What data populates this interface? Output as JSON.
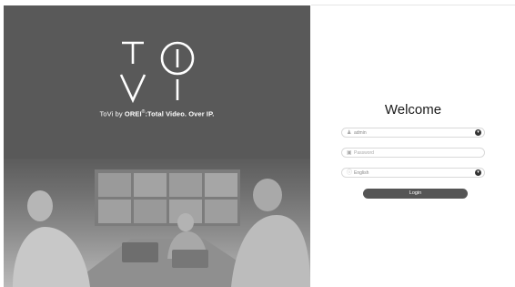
{
  "brand": {
    "logo_text": "ToVi",
    "tagline_prefix": "ToVi",
    "tagline_by": "by",
    "tagline_company": "OREI",
    "tagline_registered": "®",
    "tagline_suffix": ":Total Video. Over IP."
  },
  "login": {
    "title": "Welcome",
    "username_value": "admin",
    "password_placeholder": "Password",
    "language_value": "English",
    "submit_label": "Login"
  },
  "icons": {
    "user": "user-icon",
    "lock": "lock-icon",
    "language": "globe-icon",
    "dropdown": "chevron-down-icon"
  },
  "colors": {
    "left_panel": "#595959",
    "button": "#555555",
    "dropdown_badge": "#333333"
  }
}
